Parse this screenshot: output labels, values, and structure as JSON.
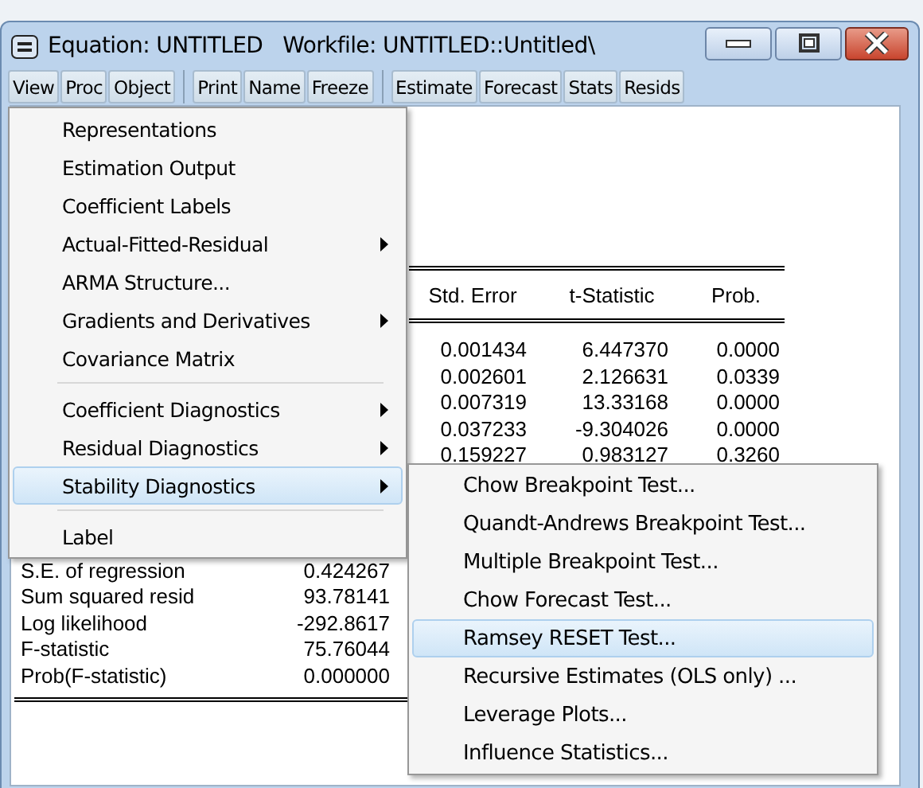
{
  "window": {
    "title": "Equation: UNTITLED   Workfile: UNTITLED::Untitled\\"
  },
  "toolbar": [
    [
      "View",
      "Proc",
      "Object"
    ],
    [
      "Print",
      "Name",
      "Freeze"
    ],
    [
      "Estimate",
      "Forecast",
      "Stats",
      "Resids"
    ]
  ],
  "table": {
    "columns": [
      "Std. Error",
      "t-Statistic",
      "Prob."
    ],
    "rows": [
      [
        "0.001434",
        "6.447370",
        "0.0000"
      ],
      [
        "0.002601",
        "2.126631",
        "0.0339"
      ],
      [
        "0.007319",
        "13.33168",
        "0.0000"
      ],
      [
        "0.037233",
        "-9.304026",
        "0.0000"
      ],
      [
        "0.159227",
        "0.983127",
        "0.3260"
      ]
    ]
  },
  "stats": [
    {
      "label": "S.E. of regression",
      "value": "0.424267"
    },
    {
      "label": "Sum squared resid",
      "value": "93.78141"
    },
    {
      "label": "Log likelihood",
      "value": "-292.8617"
    },
    {
      "label": "F-statistic",
      "value": "75.76044"
    },
    {
      "label": "Prob(F-statistic)",
      "value": "0.000000"
    }
  ],
  "menu": [
    {
      "kind": "item",
      "label": "Representations",
      "submenu": false,
      "selected": false
    },
    {
      "kind": "item",
      "label": "Estimation Output",
      "submenu": false,
      "selected": false
    },
    {
      "kind": "item",
      "label": "Coefficient Labels",
      "submenu": false,
      "selected": false
    },
    {
      "kind": "item",
      "label": "Actual-Fitted-Residual",
      "submenu": true,
      "selected": false
    },
    {
      "kind": "item",
      "label": "ARMA Structure...",
      "submenu": false,
      "selected": false
    },
    {
      "kind": "item",
      "label": "Gradients and Derivatives",
      "submenu": true,
      "selected": false
    },
    {
      "kind": "item",
      "label": "Covariance Matrix",
      "submenu": false,
      "selected": false
    },
    {
      "kind": "separator"
    },
    {
      "kind": "item",
      "label": "Coefficient Diagnostics",
      "submenu": true,
      "selected": false
    },
    {
      "kind": "item",
      "label": "Residual Diagnostics",
      "submenu": true,
      "selected": false
    },
    {
      "kind": "item",
      "label": "Stability Diagnostics",
      "submenu": true,
      "selected": true
    },
    {
      "kind": "separator"
    },
    {
      "kind": "item",
      "label": "Label",
      "submenu": false,
      "selected": false
    }
  ],
  "submenu": [
    {
      "label": "Chow Breakpoint Test...",
      "selected": false
    },
    {
      "label": "Quandt-Andrews Breakpoint Test...",
      "selected": false
    },
    {
      "label": "Multiple Breakpoint Test...",
      "selected": false
    },
    {
      "label": "Chow Forecast Test...",
      "selected": false
    },
    {
      "label": "Ramsey RESET Test...",
      "selected": true
    },
    {
      "label": "Recursive Estimates (OLS only) ...",
      "selected": false
    },
    {
      "label": "Leverage Plots...",
      "selected": false
    },
    {
      "label": "Influence Statistics...",
      "selected": false
    }
  ]
}
